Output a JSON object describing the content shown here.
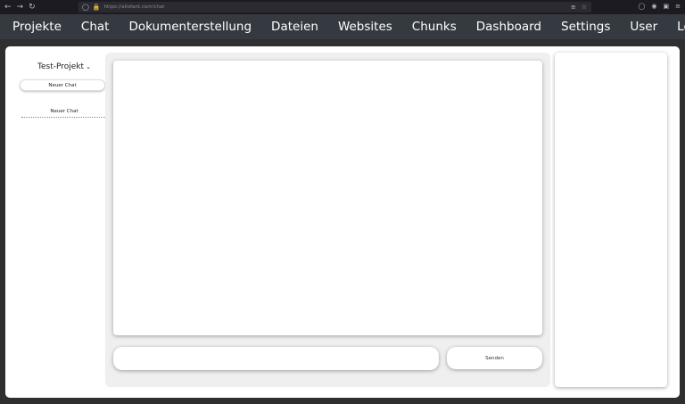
{
  "browser": {
    "url_host": "https://ailofant.com",
    "url_path": "/chat",
    "icons": [
      "back-icon",
      "forward-icon",
      "reload-icon",
      "shield-icon",
      "lock-icon",
      "translate-icon",
      "star-icon",
      "pocket-icon",
      "account-icon",
      "extensions-icon",
      "menu-icon"
    ]
  },
  "nav": {
    "items": [
      "Projekte",
      "Chat",
      "Dokumenterstellung",
      "Dateien",
      "Websites",
      "Chunks",
      "Dashboard",
      "Settings",
      "User",
      "Logout"
    ],
    "background": "#343a40"
  },
  "sidebar": {
    "project_name": "Test-Projekt",
    "new_chat_label": "Neuer Chat",
    "chats": [
      "Neuer Chat"
    ]
  },
  "chat": {
    "input_value": "",
    "send_label": "Senden"
  }
}
